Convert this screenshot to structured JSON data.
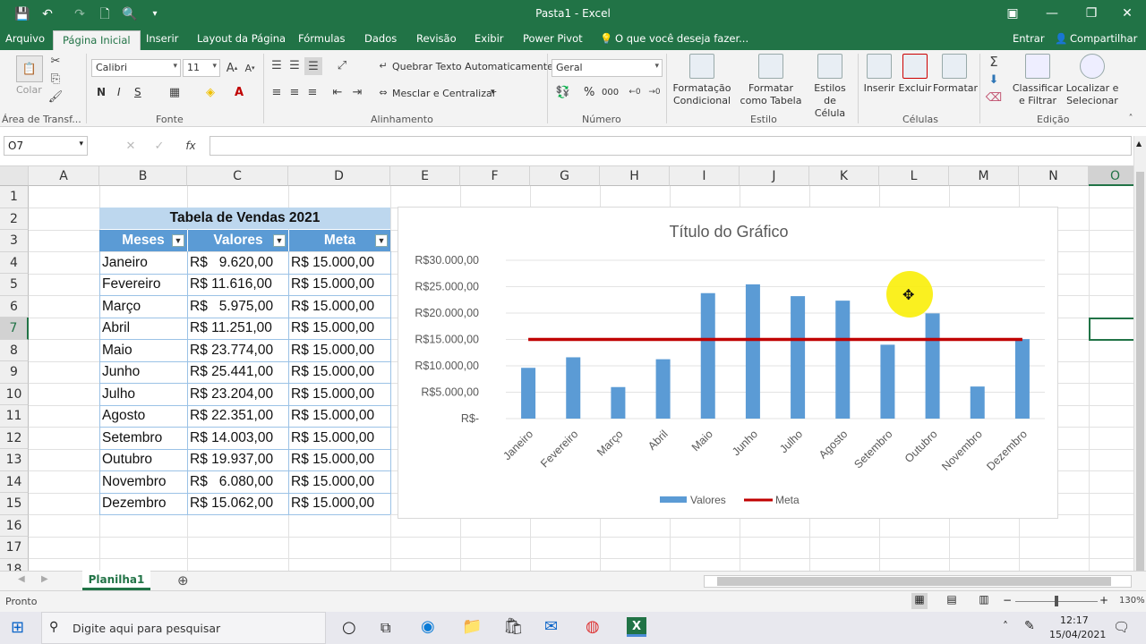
{
  "titlebar": {
    "title": "Pasta1 - Excel",
    "quick": [
      "💾",
      "↶",
      "↷",
      "🗋",
      "🔍",
      "▾"
    ],
    "ctrls": [
      "▣",
      "—",
      "❐",
      "✕"
    ]
  },
  "tabs": [
    "Arquivo",
    "Página Inicial",
    "Inserir",
    "Layout da Página",
    "Fórmulas",
    "Dados",
    "Revisão",
    "Exibir",
    "Power Pivot",
    "O que você deseja fazer..."
  ],
  "tab_right": {
    "entrar": "Entrar",
    "share": "Compartilhar"
  },
  "ribbon": {
    "clipboard": {
      "colar": "Colar",
      "group": "Área de Transf..."
    },
    "font": {
      "name": "Calibri",
      "size": "11",
      "bold": "N",
      "italic": "I",
      "underline": "S",
      "group": "Fonte"
    },
    "align": {
      "wrap": "Quebrar Texto Automaticamente",
      "merge": "Mesclar e Centralizar",
      "group": "Alinhamento"
    },
    "number": {
      "format": "Geral",
      "pct": "%",
      "thousand": "000",
      "group": "Número"
    },
    "styles": {
      "cond": "Formatação Condicional",
      "table": "Formatar como Tabela",
      "cell": "Estilos de Célula",
      "group": "Estilo"
    },
    "cells": {
      "insert": "Inserir",
      "delete": "Excluir",
      "format": "Formatar",
      "group": "Células"
    },
    "editing": {
      "sort": "Classificar e Filtrar",
      "find": "Localizar e Selecionar",
      "group": "Edição"
    }
  },
  "formula_bar": {
    "namebox": "O7",
    "fx": "fx",
    "value": ""
  },
  "columns": [
    "A",
    "B",
    "C",
    "D",
    "E",
    "F",
    "G",
    "H",
    "I",
    "J",
    "K",
    "L",
    "M",
    "N",
    "O"
  ],
  "rows": [
    "1",
    "2",
    "3",
    "4",
    "5",
    "6",
    "7",
    "8",
    "9",
    "10",
    "11",
    "12",
    "13",
    "14",
    "15",
    "16",
    "17",
    "18"
  ],
  "table": {
    "title": "Tabela de Vendas 2021",
    "headers": [
      "Meses",
      "Valores",
      "Meta"
    ],
    "rows": [
      [
        "Janeiro",
        "R$   9.620,00",
        "R$ 15.000,00"
      ],
      [
        "Fevereiro",
        "R$ 11.616,00",
        "R$ 15.000,00"
      ],
      [
        "Março",
        "R$   5.975,00",
        "R$ 15.000,00"
      ],
      [
        "Abril",
        "R$ 11.251,00",
        "R$ 15.000,00"
      ],
      [
        "Maio",
        "R$ 23.774,00",
        "R$ 15.000,00"
      ],
      [
        "Junho",
        "R$ 25.441,00",
        "R$ 15.000,00"
      ],
      [
        "Julho",
        "R$ 23.204,00",
        "R$ 15.000,00"
      ],
      [
        "Agosto",
        "R$ 22.351,00",
        "R$ 15.000,00"
      ],
      [
        "Setembro",
        "R$ 14.003,00",
        "R$ 15.000,00"
      ],
      [
        "Outubro",
        "R$ 19.937,00",
        "R$ 15.000,00"
      ],
      [
        "Novembro",
        "R$   6.080,00",
        "R$ 15.000,00"
      ],
      [
        "Dezembro",
        "R$ 15.062,00",
        "R$ 15.000,00"
      ]
    ]
  },
  "chart_data": {
    "type": "bar",
    "title": "Título do Gráfico",
    "categories": [
      "Janeiro",
      "Fevereiro",
      "Março",
      "Abril",
      "Maio",
      "Junho",
      "Julho",
      "Agosto",
      "Setembro",
      "Outubro",
      "Novembro",
      "Dezembro"
    ],
    "series": [
      {
        "name": "Valores",
        "type": "bar",
        "color": "#5b9bd5",
        "values": [
          9620,
          11616,
          5975,
          11251,
          23774,
          25441,
          23204,
          22351,
          14003,
          19937,
          6080,
          15062
        ]
      },
      {
        "name": "Meta",
        "type": "line",
        "color": "#c00000",
        "values": [
          15000,
          15000,
          15000,
          15000,
          15000,
          15000,
          15000,
          15000,
          15000,
          15000,
          15000,
          15000
        ]
      }
    ],
    "yticks": [
      "R$-",
      "R$5.000,00",
      "R$10.000,00",
      "R$15.000,00",
      "R$20.000,00",
      "R$25.000,00",
      "R$30.000,00"
    ],
    "ylim": [
      0,
      30000
    ],
    "grid": true,
    "legend": "bottom"
  },
  "sheets": {
    "active": "Planilha1",
    "add": "⊕"
  },
  "status": {
    "ready": "Pronto",
    "zoom": "130%"
  },
  "taskbar": {
    "search": "Digite aqui para pesquisar",
    "time": "12:17",
    "date": "15/04/2021"
  }
}
